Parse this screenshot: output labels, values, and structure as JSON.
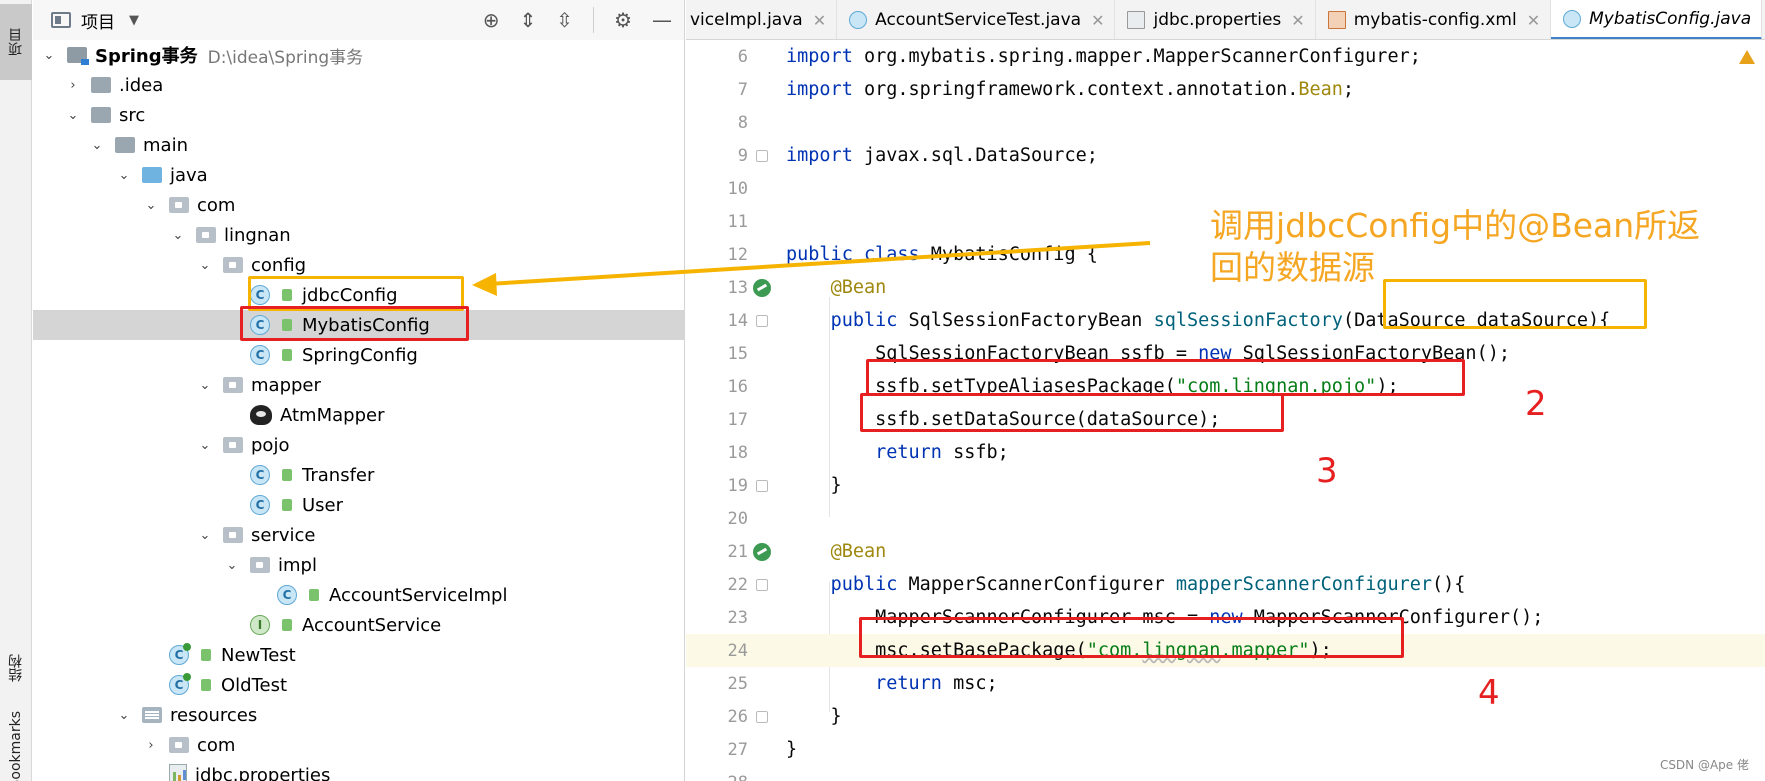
{
  "toolstrip": {
    "project": "项目",
    "structure": "结构",
    "bookmarks": "Bookmarks"
  },
  "project_panel": {
    "title": "项目",
    "tree": [
      {
        "label": "Spring事务",
        "path": "D:\\idea\\Spring事务",
        "icon": "project-folder-icon"
      },
      {
        "label": ".idea",
        "icon": "folder-icon"
      },
      {
        "label": "src",
        "icon": "folder-icon"
      },
      {
        "label": "main",
        "icon": "folder-icon"
      },
      {
        "label": "java",
        "icon": "source-folder-icon"
      },
      {
        "label": "com",
        "icon": "package-icon"
      },
      {
        "label": "lingnan",
        "icon": "package-icon"
      },
      {
        "label": "config",
        "icon": "package-icon"
      },
      {
        "label": "jdbcConfig",
        "icon": "class-icon"
      },
      {
        "label": "MybatisConfig",
        "icon": "class-icon"
      },
      {
        "label": "SpringConfig",
        "icon": "class-icon"
      },
      {
        "label": "mapper",
        "icon": "package-icon"
      },
      {
        "label": "AtmMapper",
        "icon": "mybatis-mapper-icon"
      },
      {
        "label": "pojo",
        "icon": "package-icon"
      },
      {
        "label": "Transfer",
        "icon": "class-icon"
      },
      {
        "label": "User",
        "icon": "class-icon"
      },
      {
        "label": "service",
        "icon": "package-icon"
      },
      {
        "label": "impl",
        "icon": "package-icon"
      },
      {
        "label": "AccountServiceImpl",
        "icon": "class-icon"
      },
      {
        "label": "AccountService",
        "icon": "interface-icon"
      },
      {
        "label": "NewTest",
        "icon": "test-class-icon"
      },
      {
        "label": "OldTest",
        "icon": "test-class-icon"
      },
      {
        "label": "resources",
        "icon": "resources-folder-icon"
      },
      {
        "label": "com",
        "icon": "package-icon"
      },
      {
        "label": "jdbc.properties",
        "icon": "properties-file-icon"
      }
    ]
  },
  "editor": {
    "tabs": [
      {
        "label": "viceImpl.java",
        "active": false
      },
      {
        "label": "AccountServiceTest.java",
        "active": false
      },
      {
        "label": "jdbc.properties",
        "active": false
      },
      {
        "label": "mybatis-config.xml",
        "active": false
      },
      {
        "label": "MybatisConfig.java",
        "active": true
      }
    ],
    "line_numbers": [
      "6",
      "7",
      "8",
      "9",
      "10",
      "11",
      "12",
      "13",
      "14",
      "15",
      "16",
      "17",
      "18",
      "19",
      "20",
      "21",
      "22",
      "23",
      "24",
      "25",
      "26",
      "27",
      "28"
    ]
  },
  "annotations": {
    "callout": "调用jdbcConfig中的@Bean所返回的数据源",
    "n2": "2",
    "n3": "3",
    "n4": "4"
  },
  "watermark": "CSDN @Ape 佬",
  "colors": {
    "highlight_yellow": "#f6b400",
    "highlight_red": "#e62020",
    "annotation_orange": "#f5a623"
  }
}
